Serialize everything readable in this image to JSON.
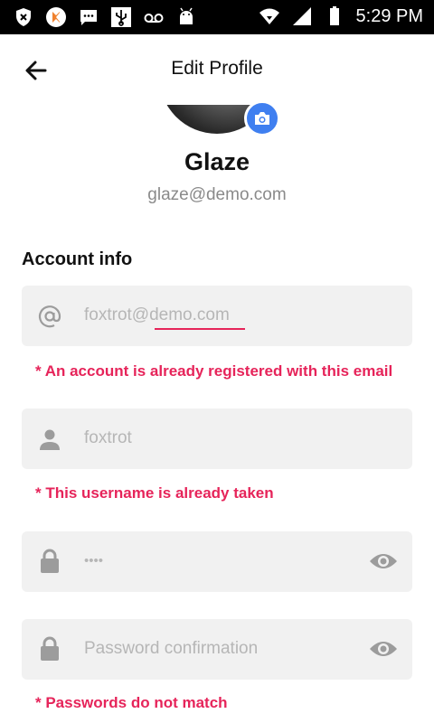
{
  "status_bar": {
    "time": "5:29 PM",
    "left_icons": [
      "shield-x-icon",
      "k-app-icon",
      "message-icon",
      "usb-icon",
      "voicemail-icon",
      "android-icon"
    ],
    "right_icons": [
      "wifi-icon",
      "signal-icon",
      "battery-icon"
    ]
  },
  "header": {
    "title": "Edit Profile",
    "back_icon": "arrow-left-icon"
  },
  "profile": {
    "name": "Glaze",
    "email": "glaze@demo.com",
    "camera_icon": "camera-icon"
  },
  "account_info": {
    "section_title": "Account info",
    "email_field": {
      "value": "foxtrot@demo.com",
      "icon": "at-icon",
      "error": "* An account is already registered with this email"
    },
    "username_field": {
      "value": "foxtrot",
      "icon": "person-icon",
      "error": "* This username is already taken"
    },
    "password_field": {
      "value": "••••",
      "icon": "lock-icon",
      "toggle_icon": "eye-icon"
    },
    "password_confirm_field": {
      "placeholder": "Password confirmation",
      "icon": "lock-icon",
      "toggle_icon": "eye-icon",
      "error": "* Passwords do not match"
    }
  },
  "colors": {
    "accent": "#3f7ff0",
    "error": "#e6245a",
    "field_bg": "#f1f1f1",
    "placeholder": "#b6b6b6"
  }
}
